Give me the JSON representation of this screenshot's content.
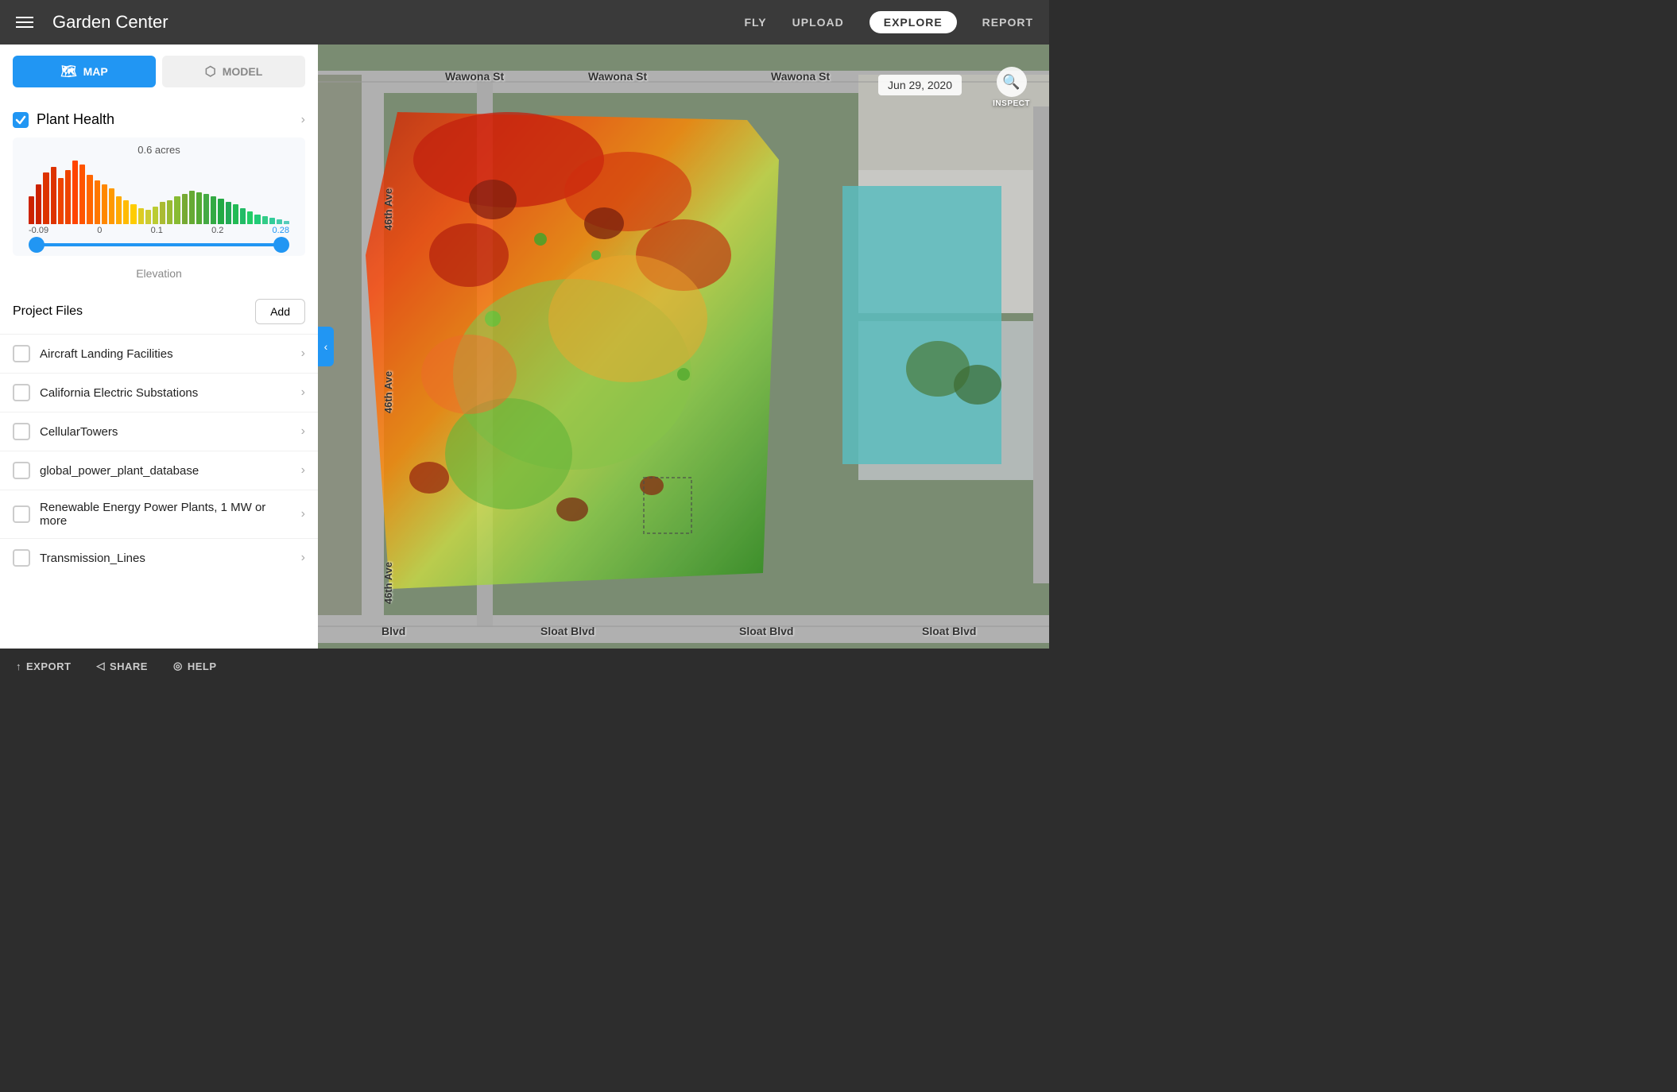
{
  "header": {
    "title": "Garden Center",
    "nav": {
      "fly": "FLY",
      "upload": "UPLOAD",
      "explore": "EXPLORE",
      "report": "REPORT"
    }
  },
  "sidebar": {
    "map_btn": "MAP",
    "model_btn": "MODEL",
    "plant_health": {
      "label": "Plant Health",
      "checked": true,
      "acres": "0.6 acres",
      "range_min": "-0.09",
      "range_zero": "0",
      "range_01": "0.1",
      "range_02": "0.2",
      "range_max": "0.28",
      "elevation_label": "Elevation"
    },
    "project_files": {
      "title": "Project Files",
      "add_btn": "Add",
      "files": [
        {
          "name": "Aircraft Landing Facilities"
        },
        {
          "name": "California Electric Substations"
        },
        {
          "name": "CellularTowers"
        },
        {
          "name": "global_power_plant_database"
        },
        {
          "name": "Renewable Energy Power Plants, 1 MW or more"
        },
        {
          "name": "Transmission_Lines"
        }
      ]
    }
  },
  "map": {
    "date": "Jun 29, 2020",
    "inspect_label": "INSPECT"
  },
  "footer": {
    "export": "EXPORT",
    "share": "SHARE",
    "help": "HELP"
  },
  "icons": {
    "hamburger": "☰",
    "map_icon": "🗺",
    "model_icon": "⬡",
    "chevron_right": "›",
    "chevron_left": "‹",
    "export_icon": "↑",
    "share_icon": "◁",
    "help_icon": "◎",
    "search_icon": "🔍"
  }
}
